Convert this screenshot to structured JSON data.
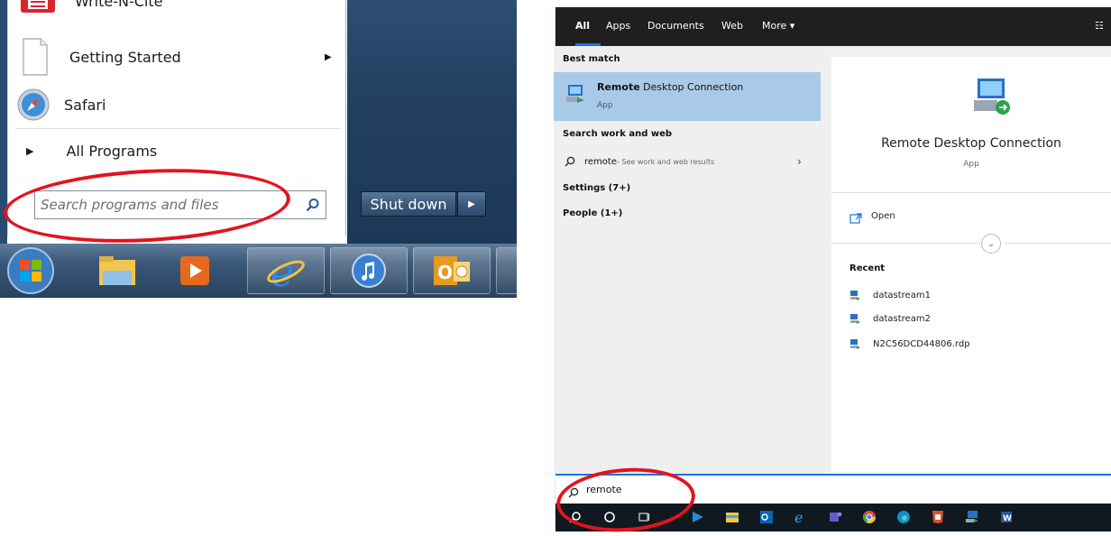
{
  "win7": {
    "top_item_label": "Write-N-Cite",
    "items": [
      {
        "label": "Getting Started"
      },
      {
        "label": "Safari"
      }
    ],
    "all_programs": "All Programs",
    "search": {
      "placeholder": "Search programs and files"
    },
    "shutdown_label": "Shut down"
  },
  "win10": {
    "tabs": [
      "All",
      "Apps",
      "Documents",
      "Web",
      "More ▾"
    ],
    "best_match_heading": "Best match",
    "best_match": {
      "title_bold": "Remote",
      "title_rest": " Desktop Connection",
      "subtitle": "App"
    },
    "search_work_heading": "Search work and web",
    "web_result": {
      "query": "remote",
      "suffix": " - See work and web results"
    },
    "settings_label": "Settings (7+)",
    "people_label": "People (1+)",
    "detail": {
      "title": "Remote Desktop Connection",
      "subtitle": "App",
      "open_label": "Open",
      "recent_heading": "Recent",
      "recent": [
        "datastream1",
        "datastream2",
        "N2C56DCD44806.rdp"
      ]
    },
    "search_value": "remote"
  },
  "colors": {
    "annotation_red": "#e5121e",
    "selection_blue": "#a9c9e8",
    "accent_blue": "#1a73e8"
  }
}
